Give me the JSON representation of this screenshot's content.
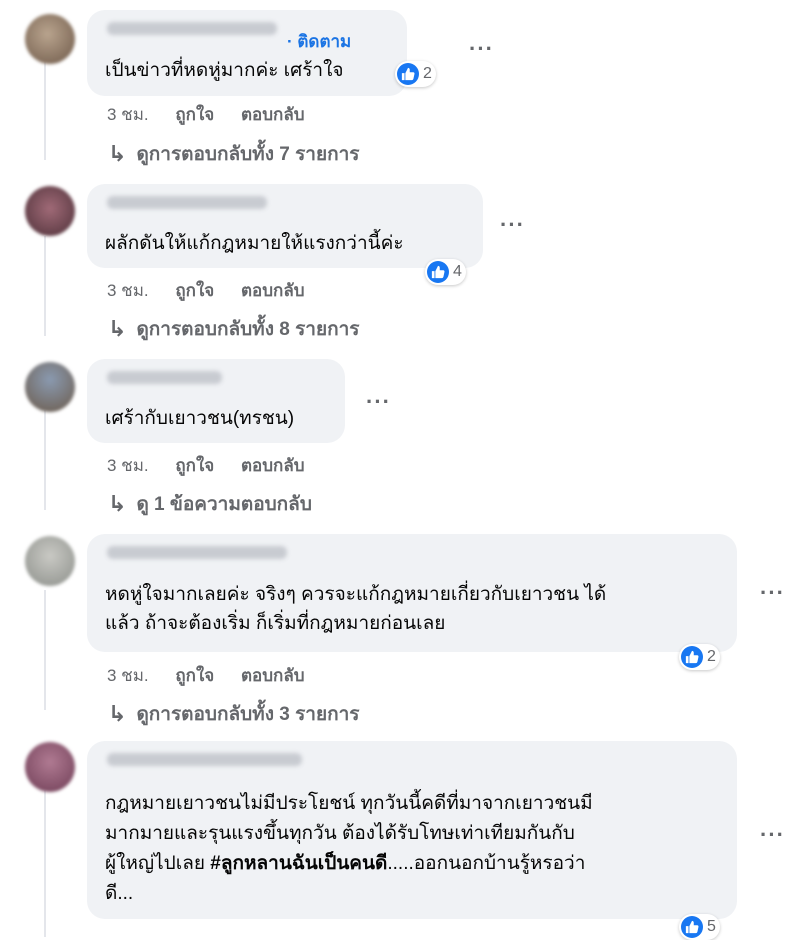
{
  "follow_label": "· ติดตาม",
  "more_label": "···",
  "comments": [
    {
      "lines": [
        "เป็นข่าวที่หดหู่มากค่ะ เศร้าใจ"
      ],
      "reactions": "2",
      "time": "3 ชม.",
      "like": "ถูกใจ",
      "reply": "ตอบกลับ",
      "view_replies": "ดูการตอบกลับทั้ง 7 รายการ"
    },
    {
      "lines": [
        "ผลักดันให้แก้กฎหมายให้แรงกว่านี้ค่ะ"
      ],
      "reactions": "4",
      "time": "3 ชม.",
      "like": "ถูกใจ",
      "reply": "ตอบกลับ",
      "view_replies": "ดูการตอบกลับทั้ง 8 รายการ"
    },
    {
      "lines": [
        "เศร้ากับเยาวชน(ทรชน)"
      ],
      "time": "3 ชม.",
      "like": "ถูกใจ",
      "reply": "ตอบกลับ",
      "view_replies": "ดู 1 ข้อความตอบกลับ"
    },
    {
      "lines": [
        "หดหู่ใจมากเลยค่ะ จริงๆ ควรจะแก้กฎหมายเกี่ยวกับเยาวชน ได้",
        "แล้ว ถ้าจะต้องเริ่ม ก็เริ่มที่กฎหมายก่อนเลย"
      ],
      "reactions": "2",
      "time": "3 ชม.",
      "like": "ถูกใจ",
      "reply": "ตอบกลับ",
      "view_replies": "ดูการตอบกลับทั้ง 3 รายการ"
    },
    {
      "lines": [
        "กฎหมายเยาวชนไม่มีประโยชน์ ทุกวันนี้คดีที่มาจากเยาวชนมี",
        "มากมายและรุนแรงขึ้นทุกวัน ต้องได้รับโทษเท่าเทียมกันกับ"
      ],
      "line3_prefix": "ผู้ใหญ่ไปเลย ",
      "line3_hashtag": "#ลูกหลานฉันเป็นคนดี",
      "line3_suffix": ".....ออกนอกบ้านรู้หรอว่า",
      "line4": "ดี...",
      "reactions": "5"
    }
  ],
  "colors": {
    "bubble": "#f0f2f5",
    "link": "#1b74e4",
    "like": "#1877f2",
    "secondary_text": "#65676b"
  }
}
